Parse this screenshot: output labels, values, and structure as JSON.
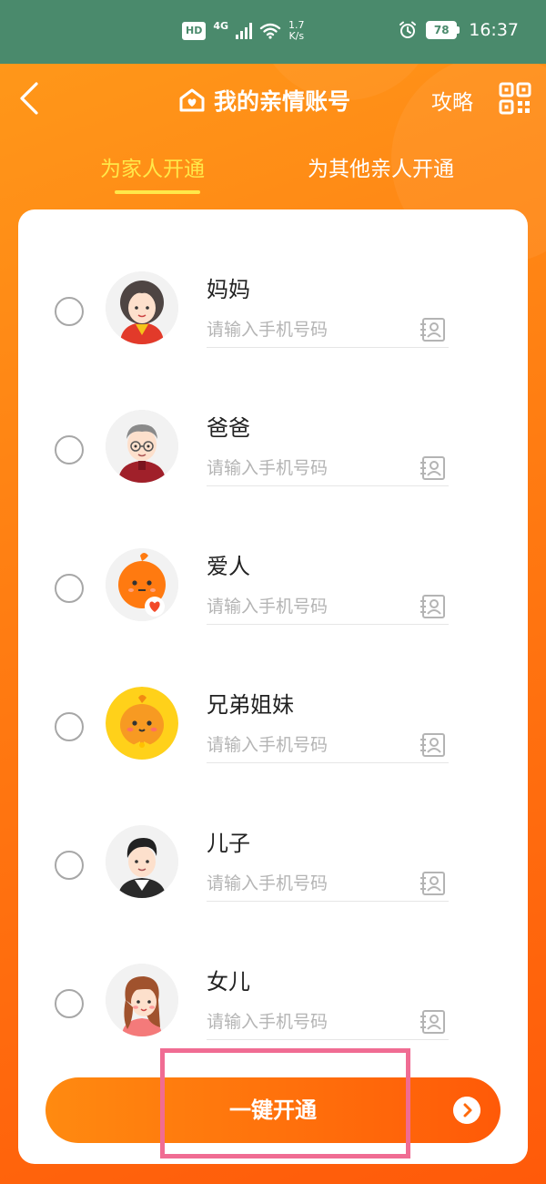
{
  "status_bar": {
    "hd": "HD",
    "network": "4G",
    "speed_value": "1.7",
    "speed_unit": "K/s",
    "battery": "78",
    "time": "16:37"
  },
  "header": {
    "back_icon": "chevron-left-icon",
    "title": "我的亲情账号",
    "guide_label": "攻略",
    "qr_icon": "qr-code-icon"
  },
  "tabs": [
    {
      "label": "为家人开通",
      "active": true
    },
    {
      "label": "为其他亲人开通",
      "active": false
    }
  ],
  "members": [
    {
      "name": "妈妈",
      "placeholder": "请输入手机号码",
      "avatar": "mother-avatar"
    },
    {
      "name": "爸爸",
      "placeholder": "请输入手机号码",
      "avatar": "father-avatar"
    },
    {
      "name": "爱人",
      "placeholder": "请输入手机号码",
      "avatar": "spouse-avatar"
    },
    {
      "name": "兄弟姐妹",
      "placeholder": "请输入手机号码",
      "avatar": "sibling-avatar"
    },
    {
      "name": "儿子",
      "placeholder": "请输入手机号码",
      "avatar": "son-avatar"
    },
    {
      "name": "女儿",
      "placeholder": "请输入手机号码",
      "avatar": "daughter-avatar"
    }
  ],
  "action": {
    "open_label": "一键开通"
  },
  "colors": {
    "accent": "#ff7a10",
    "tab_active": "#ffe84a",
    "status_bar": "#4a8a6c",
    "highlight": "#f06c93"
  }
}
